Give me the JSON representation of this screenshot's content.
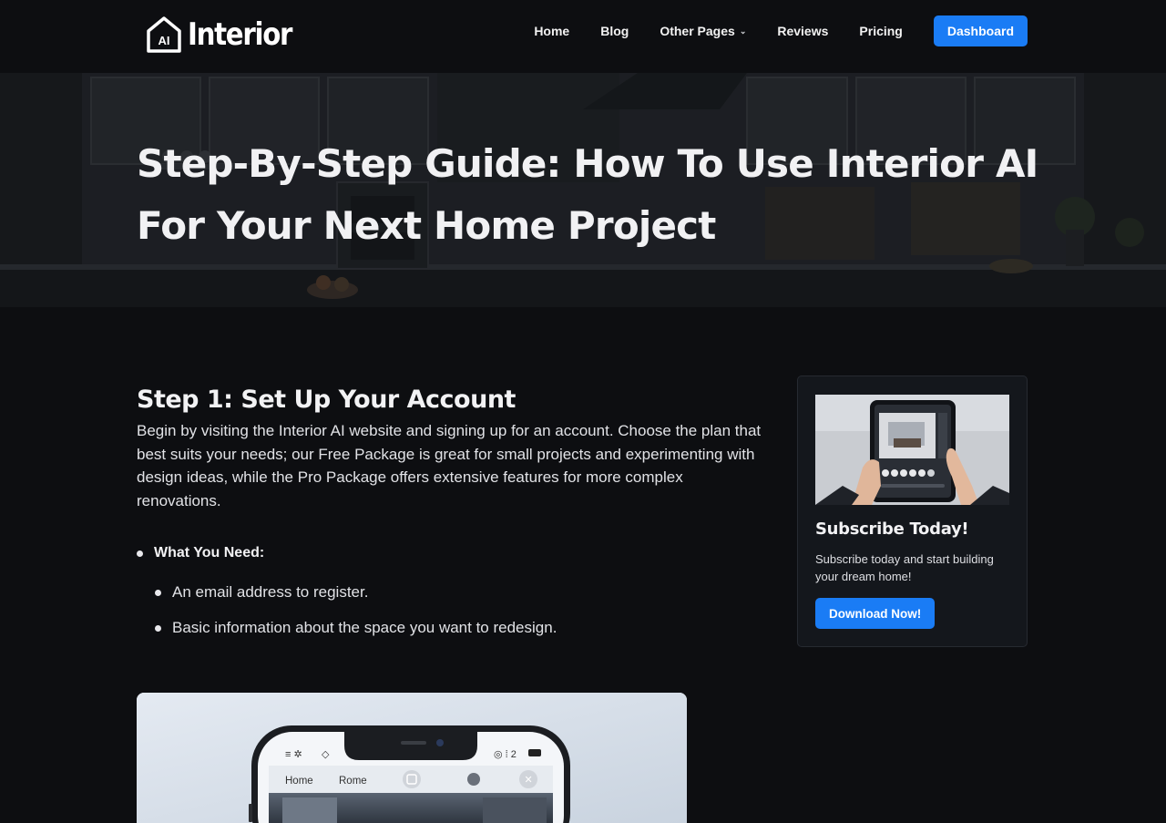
{
  "header": {
    "logo_mark": "AI",
    "logo_word": "Interior",
    "nav": [
      {
        "label": "Home"
      },
      {
        "label": "Blog"
      },
      {
        "label": "Other Pages"
      },
      {
        "label": "Reviews"
      },
      {
        "label": "Pricing"
      }
    ],
    "cta_label": "Dashboard"
  },
  "hero": {
    "title_line1": "Step-By-Step Guide: How To Use Interior AI",
    "title_line2": "For Your Next Home Project"
  },
  "article": {
    "step_title": "Step 1: Set Up Your Account",
    "step_text": "Begin by visiting the Interior AI website and signing up for an account. Choose the plan that best suits your needs; our Free Package is great for small projects and experimenting with design ideas, while the Pro Package offers extensive features for more complex renovations.",
    "needs_heading": "What You Need:",
    "needs": [
      "An email address to register.",
      "Basic information about the space you want to redesign."
    ],
    "phone_tabs": [
      "Home",
      "Rome"
    ]
  },
  "sidebar": {
    "title": "Subscribe Today!",
    "text": "Subscribe today and start building your dream home!",
    "button_label": "Download Now!"
  },
  "colors": {
    "accent": "#1a7cf5",
    "background": "#0d0e11",
    "card": "#14171c"
  }
}
